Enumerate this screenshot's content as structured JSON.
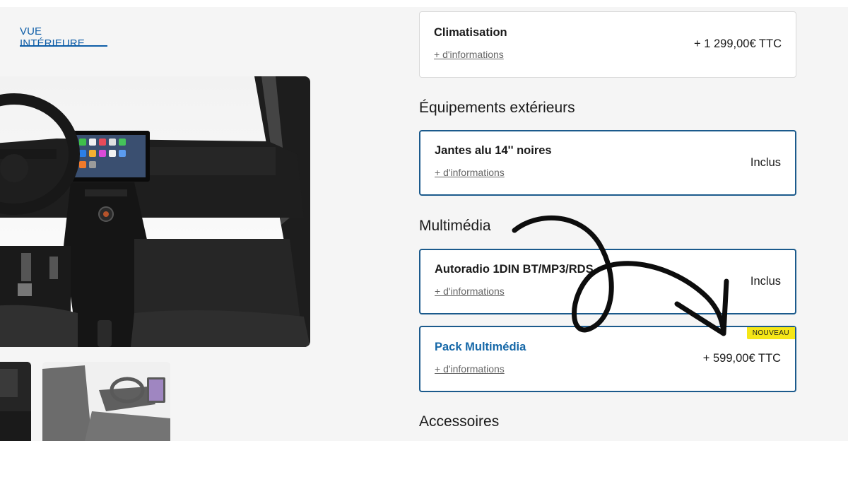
{
  "gallery": {
    "tab_label": "VUE INTÉRIEURE"
  },
  "options": {
    "climatisation": {
      "title": "Climatisation",
      "link": "+ d'informations",
      "price": "+ 1 299,00€ TTC"
    },
    "section_exterieur": "Équipements extérieurs",
    "jantes": {
      "title": "Jantes alu 14'' noires",
      "link": "+ d'informations",
      "price": "Inclus"
    },
    "section_multimedia": "Multimédia",
    "autoradio": {
      "title": "Autoradio 1DIN BT/MP3/RDS",
      "link": "+ d'informations",
      "price": "Inclus"
    },
    "pack_multimedia": {
      "title": "Pack Multimédia",
      "link": "+ d'informations",
      "price": "+ 599,00€ TTC",
      "badge": "NOUVEAU"
    },
    "section_accessoires": "Accessoires"
  },
  "colors": {
    "accent_blue": "#1668a8",
    "card_border_selected": "#1b5a8c",
    "badge_yellow": "#f5e617",
    "background": "#f5f5f5"
  },
  "icons": {
    "annotation": "hand-drawn-arrow-icon"
  }
}
